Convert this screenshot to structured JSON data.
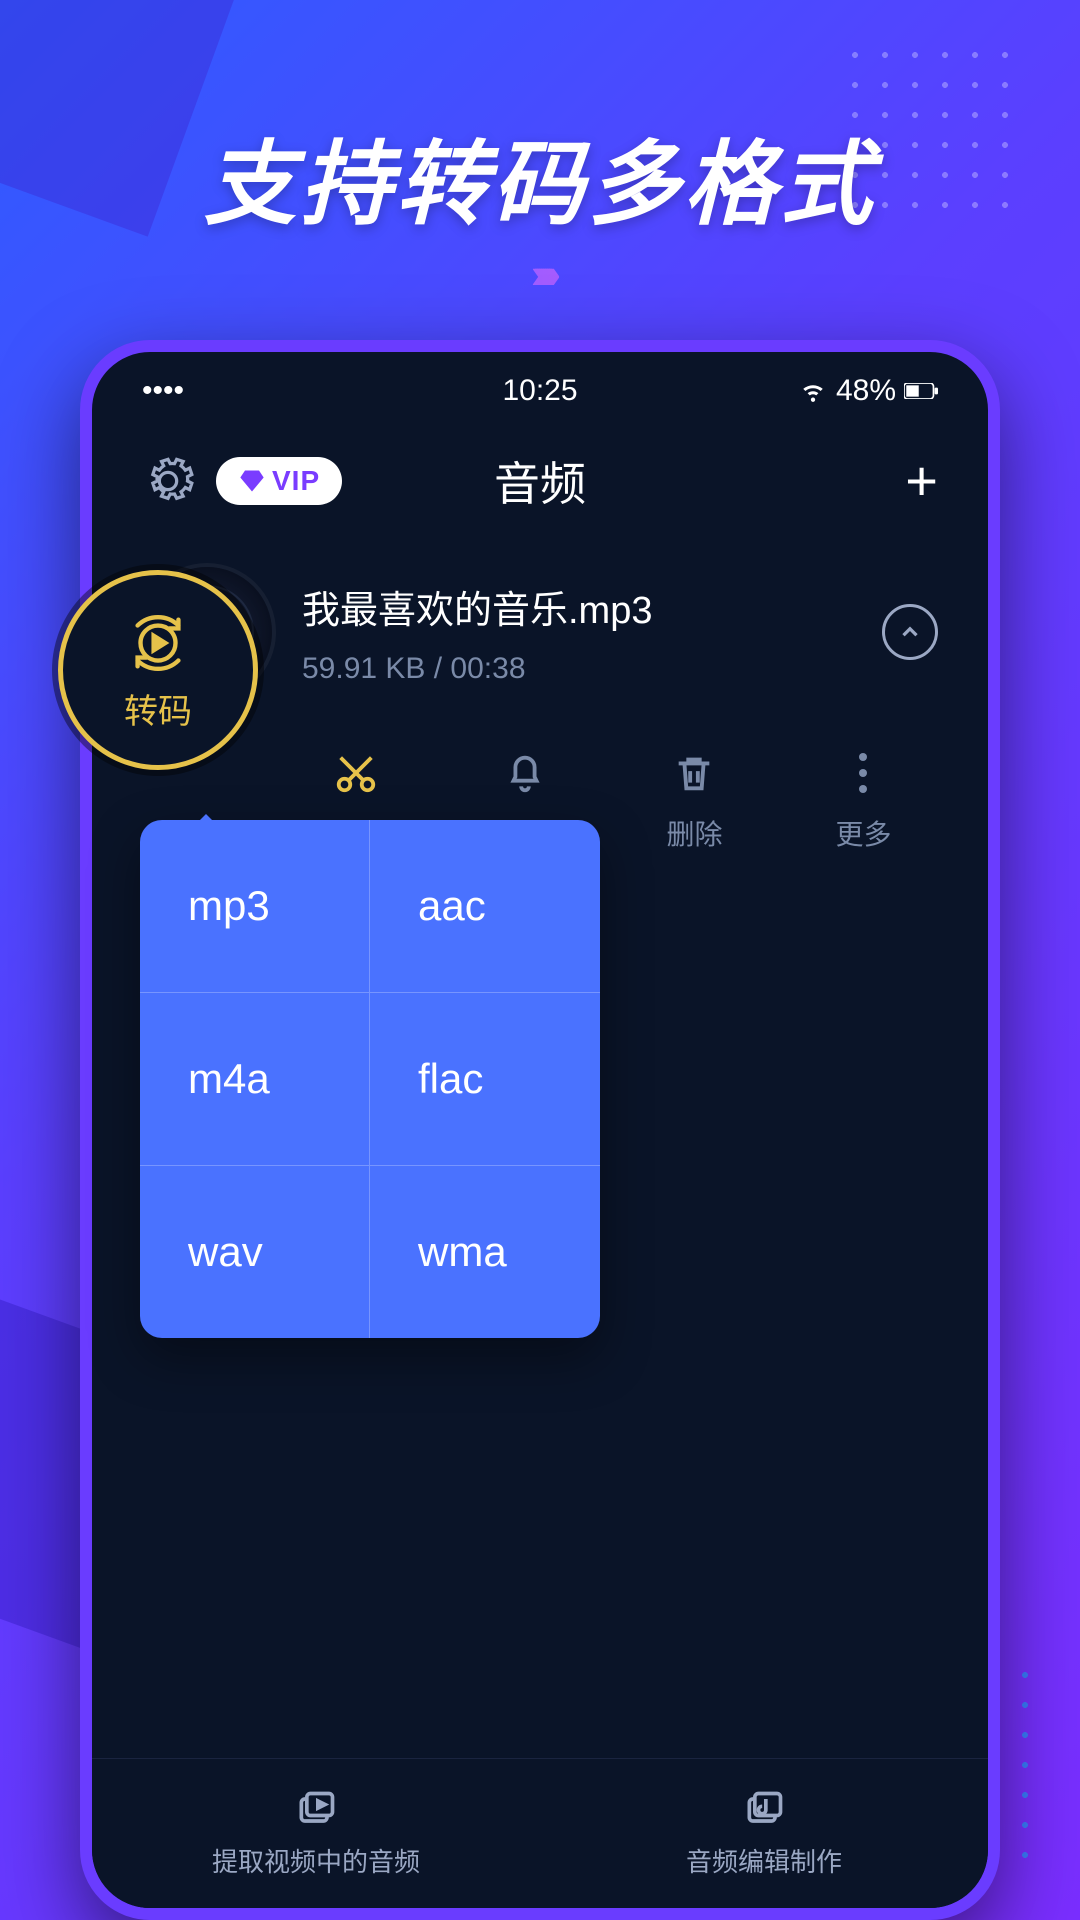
{
  "headline": "支持转码多格式",
  "statusbar": {
    "time": "10:25",
    "battery": "48%"
  },
  "appbar": {
    "vip_label": "VIP",
    "title": "音频"
  },
  "file": {
    "name": "我最喜欢的音乐.mp3",
    "meta": "59.91 KB / 00:38"
  },
  "transcode": {
    "label": "转码"
  },
  "actions": {
    "cut": "裁剪",
    "ringtone": "铃声",
    "delete": "删除",
    "more": "更多"
  },
  "formats": [
    "mp3",
    "aac",
    "m4a",
    "flac",
    "wav",
    "wma"
  ],
  "bottom_nav": {
    "extract": "提取视频中的音频",
    "edit": "音频编辑制作"
  }
}
